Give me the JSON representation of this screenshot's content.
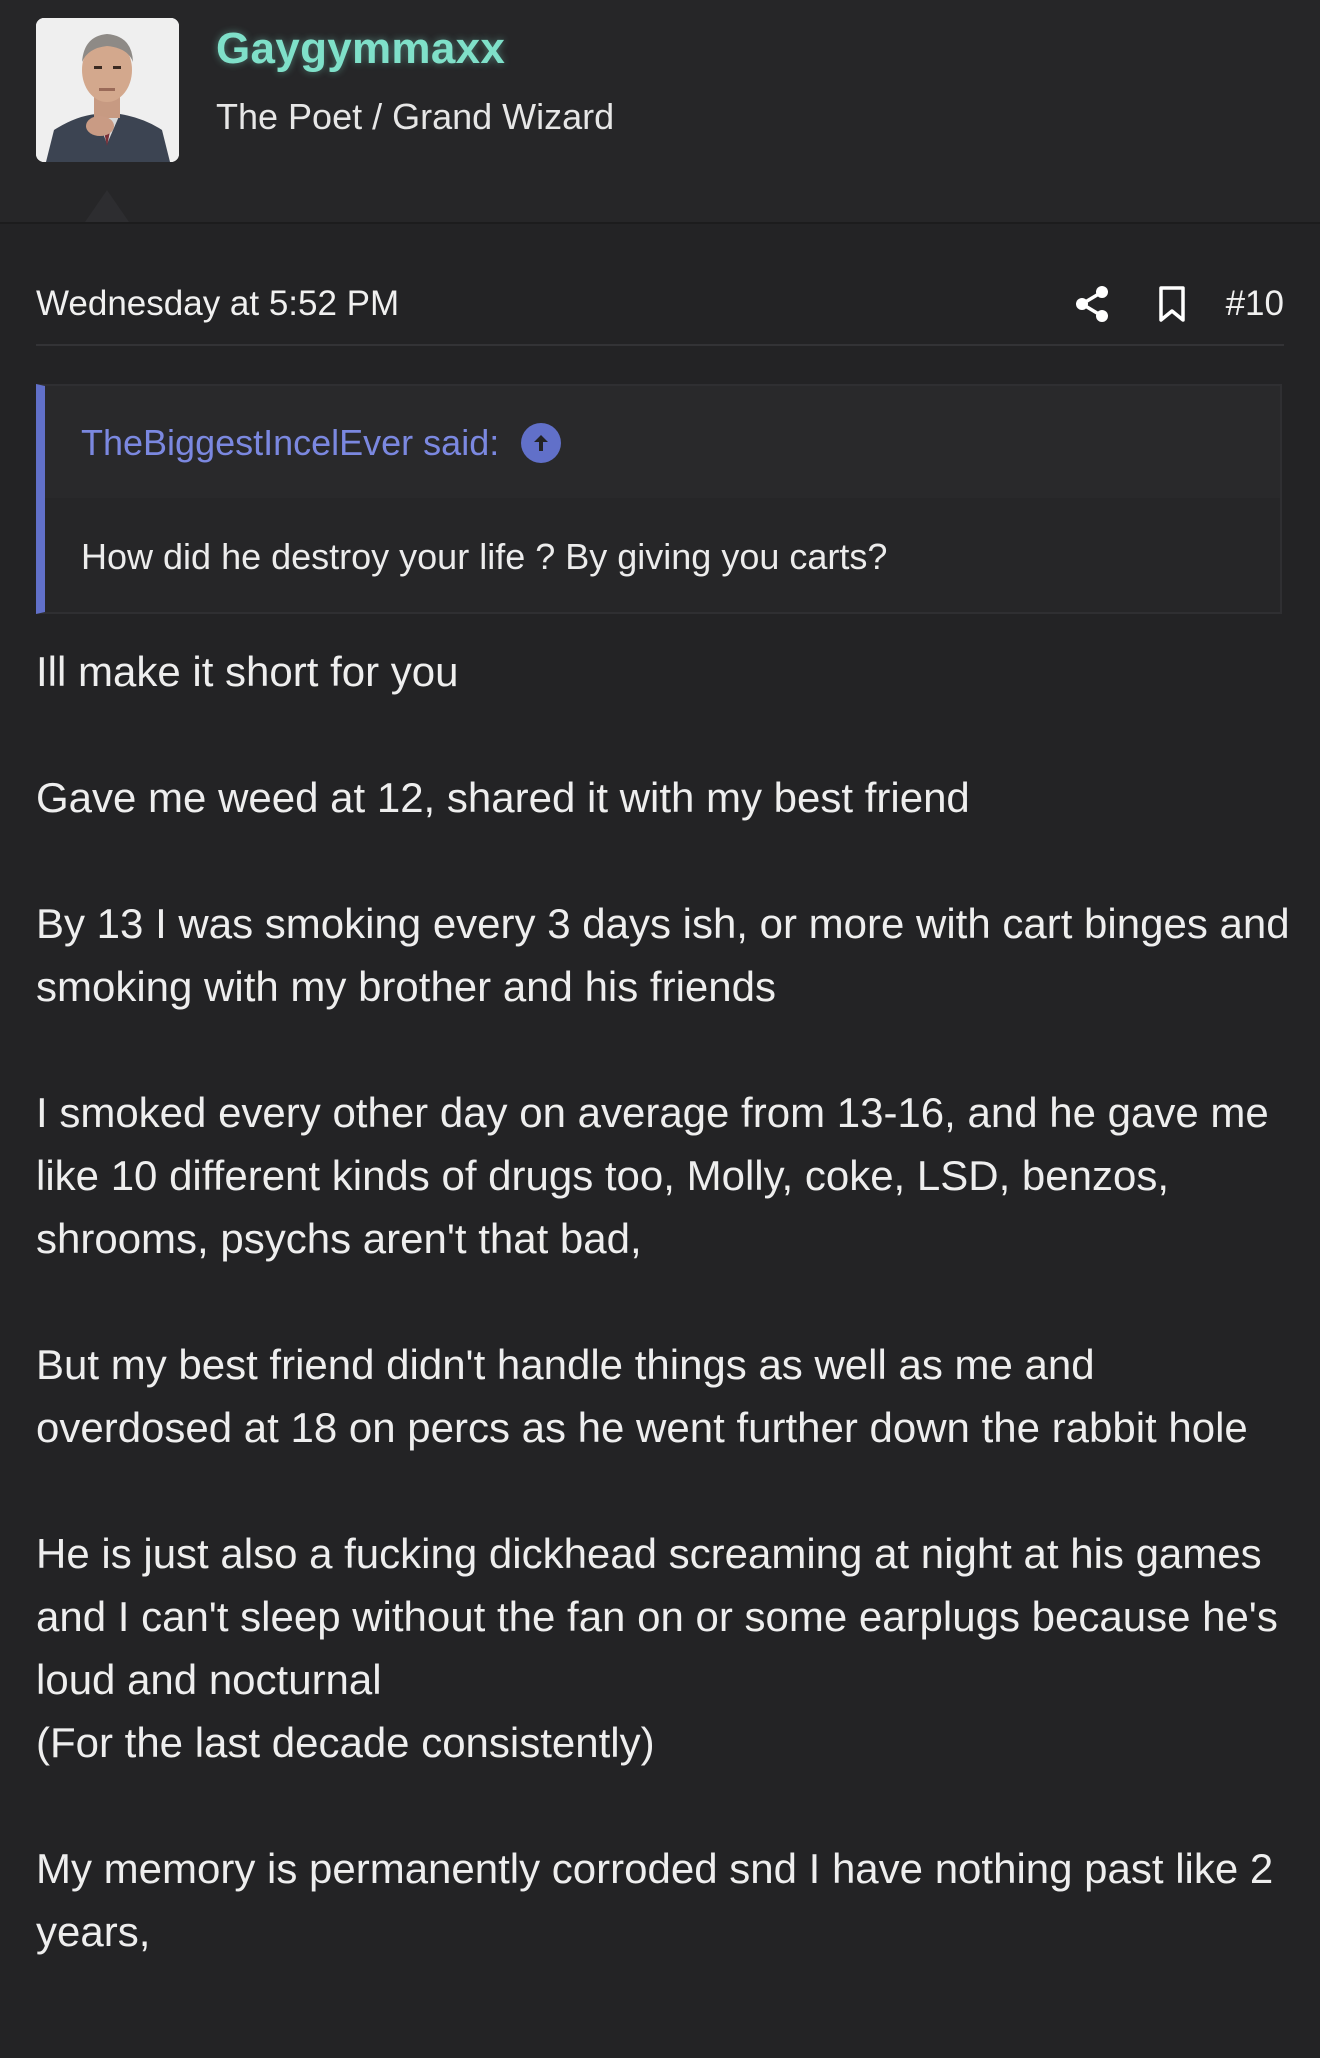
{
  "user": {
    "name": "Gaygymmaxx",
    "title": "The Poet / Grand Wizard",
    "name_color": "#7fe0c9"
  },
  "post": {
    "date": "Wednesday at 5:52 PM",
    "number": "#10",
    "actions": [
      "share-icon",
      "bookmark-icon"
    ]
  },
  "quote": {
    "attribution": "TheBiggestIncelEver said:",
    "text": "How did he destroy your life ? By giving you carts?",
    "accent_color": "#6170c9"
  },
  "message": {
    "paragraphs": [
      "Ill make it short for you",
      "Gave me weed at 12, shared it with my best friend",
      "By 13 I was smoking every 3 days ish, or more with cart binges and smoking with my brother and his friends",
      "I smoked every other day on average from 13-16, and he gave me like 10 different kinds of drugs too, Molly, coke, LSD, benzos, shrooms, psychs aren't that bad,",
      "But my best friend didn't handle things as well as me and overdosed at 18 on percs as he went further down the rabbit hole",
      "He is just also a fucking dickhead screaming at night at his games and I can't sleep without the fan on or some earplugs because he's loud and nocturnal",
      "(For the last decade consistently)",
      "My memory is permanently corroded snd I have nothing past like 2 years,"
    ]
  }
}
